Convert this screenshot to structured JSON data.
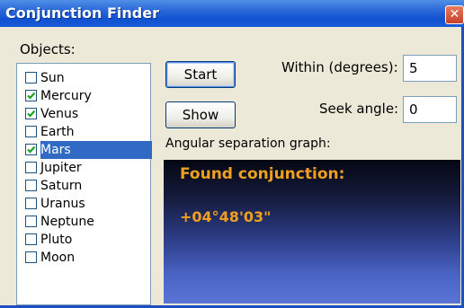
{
  "window": {
    "title": "Conjunction Finder",
    "close_symbol": "✕"
  },
  "objects": {
    "label": "Objects:",
    "items": [
      {
        "label": "Sun",
        "checked": false,
        "selected": false
      },
      {
        "label": "Mercury",
        "checked": true,
        "selected": false
      },
      {
        "label": "Venus",
        "checked": true,
        "selected": false
      },
      {
        "label": "Earth",
        "checked": false,
        "selected": false
      },
      {
        "label": "Mars",
        "checked": true,
        "selected": true
      },
      {
        "label": "Jupiter",
        "checked": false,
        "selected": false
      },
      {
        "label": "Saturn",
        "checked": false,
        "selected": false
      },
      {
        "label": "Uranus",
        "checked": false,
        "selected": false
      },
      {
        "label": "Neptune",
        "checked": false,
        "selected": false
      },
      {
        "label": "Pluto",
        "checked": false,
        "selected": false
      },
      {
        "label": "Moon",
        "checked": false,
        "selected": false
      }
    ]
  },
  "buttons": {
    "start_label": "Start",
    "show_label": "Show"
  },
  "within": {
    "label": "Within (degrees):",
    "value": "5"
  },
  "seek": {
    "label": "Seek angle:",
    "value": "0"
  },
  "graph": {
    "label": "Angular separation graph:",
    "title": "Found conjunction:",
    "value": "+04°48'03\""
  },
  "colors": {
    "title_bar": "#0f52d0",
    "selection": "#316ac5",
    "check_mark": "#21a121",
    "graph_text": "#f0a020"
  },
  "icons": {
    "close": "close-icon",
    "check": "checkmark-icon"
  }
}
